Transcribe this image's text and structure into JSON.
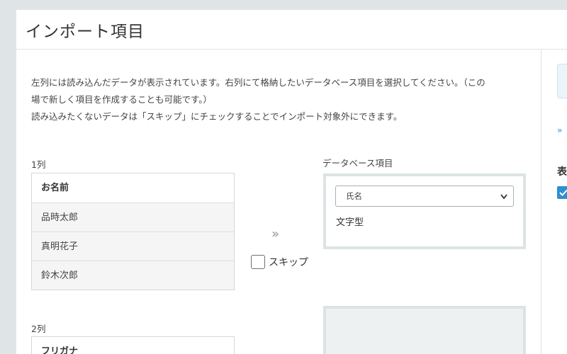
{
  "page": {
    "title": "インポート項目",
    "description_lines": [
      "左列には読み込んだデータが表示されています。右列にて格納したいデータベース項目を選択してください。（この",
      "場で新しく項目を作成することも可能です。）",
      "読み込みたくないデータは「スキップ」にチェックすることでインポート対象外にできます。"
    ]
  },
  "columns": [
    {
      "label": "1列",
      "header": "お名前",
      "rows": [
        "品時太郎",
        "真明花子",
        "鈴木次郎"
      ],
      "arrow_icon": "double-chevron-right-icon",
      "skip_label": "スキップ",
      "skip_checked": false,
      "db_label": "データベース項目",
      "db_selected": "氏名",
      "db_type": "文字型"
    },
    {
      "label": "2列",
      "header": "フリガナ"
    }
  ],
  "side": {
    "link_text": "» ",
    "heading": "表",
    "checkbox_checked": true
  },
  "colors": {
    "background": "#dfe5e6",
    "panel": "#ffffff",
    "accent": "#2f8fd0"
  }
}
